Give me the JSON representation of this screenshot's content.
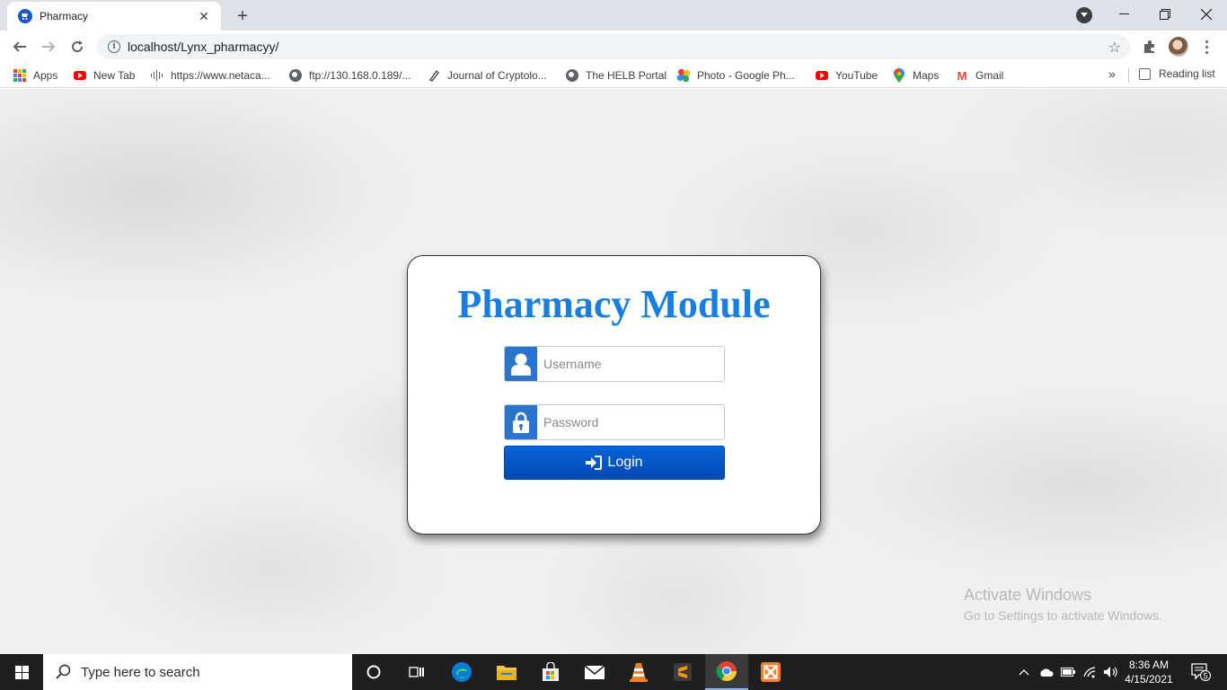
{
  "browser": {
    "tab_title": "Pharmacy",
    "new_tab_symbol": "+",
    "url": "localhost/Lynx_pharmacyy/",
    "bookmarks": [
      {
        "label": "Apps",
        "icon": "apps-grid-icon"
      },
      {
        "label": "New Tab",
        "icon": "youtube-icon"
      },
      {
        "label": "https://www.netaca...",
        "icon": "netacad-icon"
      },
      {
        "label": "ftp://130.168.0.189/...",
        "icon": "globe-icon"
      },
      {
        "label": "Journal of Cryptolo...",
        "icon": "journal-icon"
      },
      {
        "label": "The HELB Portal",
        "icon": "globe-icon"
      },
      {
        "label": "Photo - Google Ph...",
        "icon": "google-photos-icon"
      },
      {
        "label": "YouTube",
        "icon": "youtube-icon"
      },
      {
        "label": "Maps",
        "icon": "maps-pin-icon"
      },
      {
        "label": "Gmail",
        "icon": "gmail-icon"
      }
    ],
    "overflow_symbol": "»",
    "reading_list": "Reading list"
  },
  "login": {
    "title": "Pharmacy Module",
    "username_placeholder": "Username",
    "password_placeholder": "Password",
    "button_label": "Login"
  },
  "watermark": {
    "line1": "Activate Windows",
    "line2": "Go to Settings to activate Windows."
  },
  "taskbar": {
    "search_placeholder": "Type here to search",
    "time": "8:36 AM",
    "date": "4/15/2021",
    "notification_count": "5"
  },
  "colors": {
    "title_blue": "#1a7de0",
    "button_blue": "#0a63d6",
    "addon_blue": "#2a73cf"
  }
}
